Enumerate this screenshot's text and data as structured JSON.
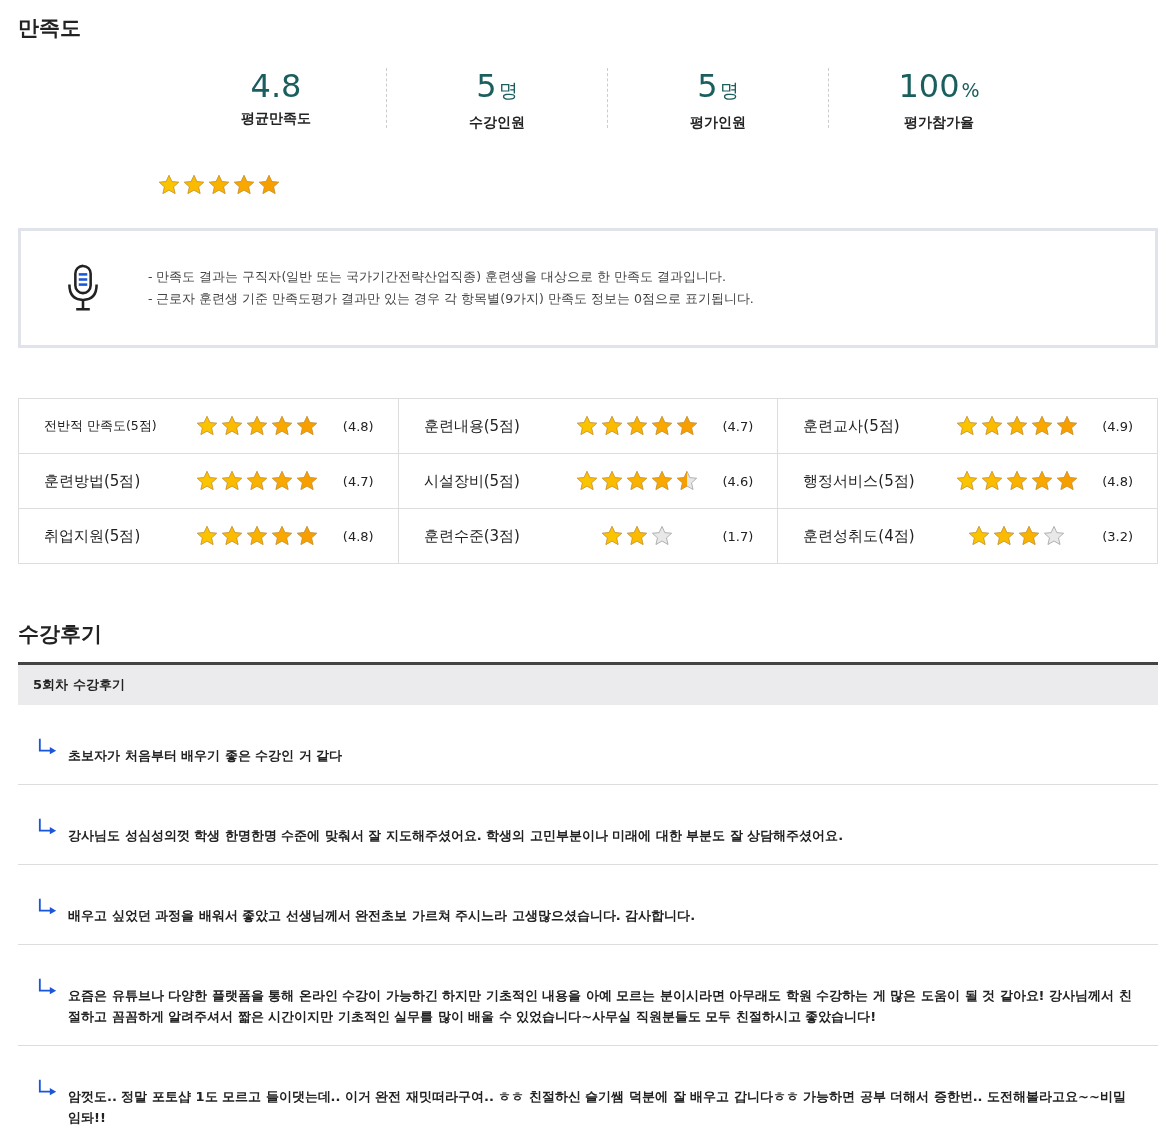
{
  "satisfaction": {
    "title": "만족도",
    "stats": [
      {
        "value": "4.8",
        "label": "평균만족도"
      },
      {
        "value": "5",
        "unit": "명",
        "label": "수강인원"
      },
      {
        "value": "5",
        "unit": "명",
        "label": "평가인원"
      },
      {
        "value": "100",
        "unit": "%",
        "label": "평가참가율"
      }
    ],
    "stars": 5,
    "notice": [
      "- 만족도 결과는 구직자(일반 또는 국가기간전략산업직종) 훈련생을 대상으로 한 만족도 결과입니다.",
      "- 근로자 훈련생 기준 만족도평가 결과만 있는 경우 각 항목별(9가지) 만족도 정보는 0점으로 표기됩니다."
    ],
    "items": [
      {
        "label": "전반적 만족도(5점)",
        "stars": 5,
        "score": "(4.8)"
      },
      {
        "label": "훈련내용(5점)",
        "stars": 5,
        "score": "(4.7)"
      },
      {
        "label": "훈련교사(5점)",
        "stars": 5,
        "score": "(4.9)"
      },
      {
        "label": "훈련방법(5점)",
        "stars": 5,
        "score": "(4.7)"
      },
      {
        "label": "시설장비(5점)",
        "stars": 4.5,
        "score": "(4.6)"
      },
      {
        "label": "행정서비스(5점)",
        "stars": 5,
        "score": "(4.8)"
      },
      {
        "label": "취업지원(5점)",
        "stars": 5,
        "score": "(4.8)"
      },
      {
        "label": "훈련수준(3점)",
        "stars": 2,
        "empty_stars": [
          {
            "kind": "empty"
          }
        ],
        "score": "(1.7)"
      },
      {
        "label": "훈련성취도(4점)",
        "stars": 3,
        "empty_stars": [
          {
            "kind": "empty"
          }
        ],
        "score": "(3.2)"
      }
    ]
  },
  "reviews": {
    "title": "수강후기",
    "header": "5회차 수강후기",
    "items": [
      "초보자가 처음부터 배우기 좋은 수강인 거 같다",
      "강사님도 성심성의껏 학생 한명한명 수준에 맞춰서 잘 지도해주셨어요. 학생의 고민부분이나 미래에 대한 부분도 잘 상담해주셨어요.",
      "배우고 싶었던 과정을 배워서 좋았고 선생님께서 완전초보 가르쳐 주시느라 고생많으셨습니다. 감사합니다.",
      "요즘은 유튜브나 다양한 플랫폼을 통해 온라인 수강이 가능하긴 하지만 기초적인 내용을 아예 모르는 분이시라면 아무래도 학원 수강하는 게 많은 도움이 될 것 같아요! 강사님께서 친절하고 꼼꼼하게 알려주셔서 짧은 시간이지만 기초적인 실무를 많이 배울 수 있었습니다~사무실 직원분들도 모두 친절하시고 좋았습니다!",
      "암껏도.. 정말 포토샵 1도 모르고 들이댓는데.. 이거 완전 재밋떠라구여.. ㅎㅎ 친절하신 슬기쌤 덕분에 잘 배우고 갑니다ㅎㅎ 가능하면 공부 더해서 증한번.. 도전해볼라고요~~비밀임돠!!"
    ]
  }
}
